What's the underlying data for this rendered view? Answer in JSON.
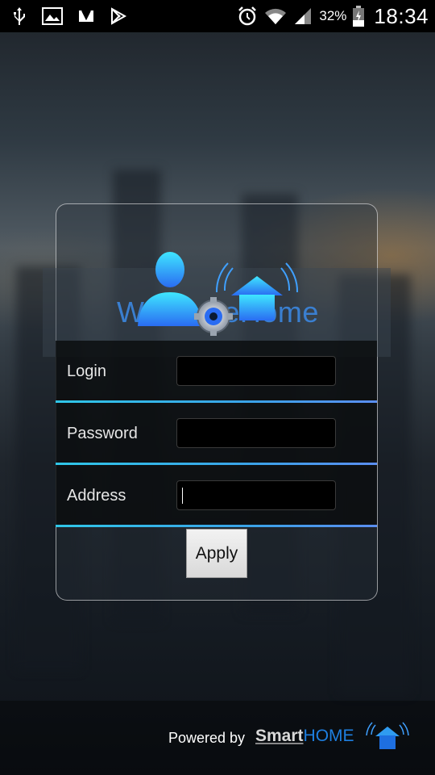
{
  "status_bar": {
    "notification_icons": [
      "usb-icon",
      "image-icon",
      "download-check-icon",
      "play-store-icon"
    ],
    "system_icons": [
      "alarm-icon",
      "wifi-icon",
      "signal-icon",
      "battery-icon"
    ],
    "battery_percent": "32%",
    "time": "18:34"
  },
  "logo": {
    "text": "WelcomeHome",
    "icons": [
      "user-icon",
      "gear-icon",
      "smart-home-icon"
    ]
  },
  "form": {
    "fields": [
      {
        "label": "Login",
        "value": ""
      },
      {
        "label": "Password",
        "value": ""
      },
      {
        "label": "Address",
        "value": ""
      }
    ],
    "apply_label": "Apply"
  },
  "footer": {
    "powered_by": "Powered by",
    "brand_smart": "Smart",
    "brand_home": "HOME"
  },
  "colors": {
    "accent_line": "#2fc6e8",
    "brand_blue": "#1e7fe0"
  }
}
